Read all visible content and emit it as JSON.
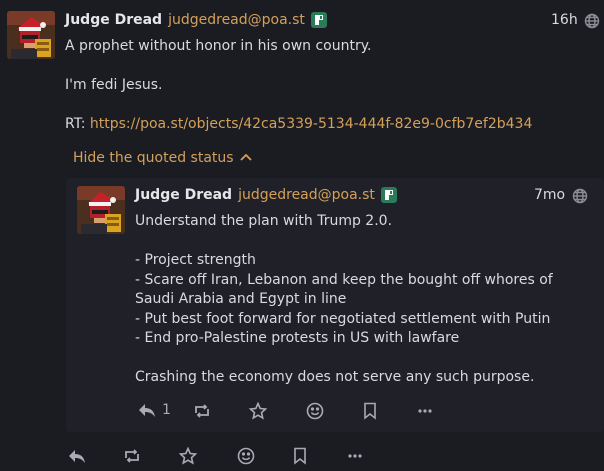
{
  "post": {
    "author_name": "Judge Dread",
    "author_handle": "judgedread@poa.st",
    "time": "16h",
    "lines": [
      "A prophet without honor in his own country.",
      "I'm fedi Jesus."
    ],
    "rt_prefix": "RT: ",
    "rt_link": "https://poa.st/objects/42ca5339-5134-444f-82e9-0cfb7ef2b434",
    "hide_quote_label": "Hide the quoted status"
  },
  "quote": {
    "author_name": "Judge Dread",
    "author_handle": "judgedread@poa.st",
    "time": "7mo",
    "lines": [
      "Understand the plan with Trump 2.0.",
      "- Project strength",
      "- Scare off Iran, Lebanon and keep the bought off whores of Saudi Arabia and Egypt in line",
      "- Put best foot forward for negotiated settlement with Putin",
      "- End pro-Palestine protests in US with lawfare",
      "Crashing the economy does not serve any such purpose."
    ],
    "reply_count": "1"
  },
  "icons": {
    "reply": "reply-icon",
    "repeat": "repeat-icon",
    "favorite": "star-icon",
    "react": "emoji-icon",
    "bookmark": "bookmark-icon",
    "more": "more-icon",
    "visibility": "globe-icon",
    "badge": "pleroma-badge-icon"
  },
  "colors": {
    "background": "#1b1c22",
    "quote_background": "#202128",
    "accent": "#d4a05a",
    "badge": "#2a7b57"
  }
}
